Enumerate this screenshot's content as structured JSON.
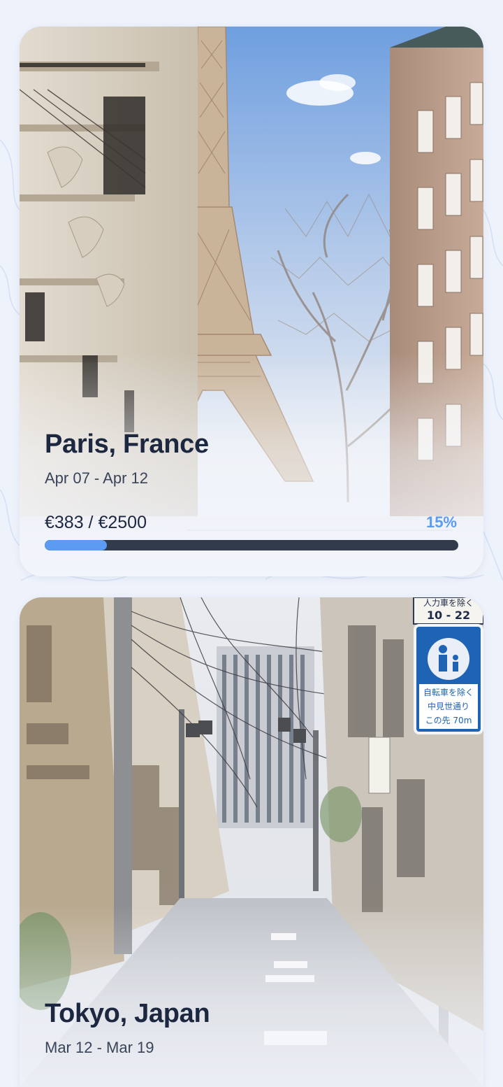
{
  "trips": [
    {
      "city": "Paris, France",
      "dates": "Apr 07 - Apr 12",
      "budget": "€383 / €2500",
      "percent_label": "15%",
      "progress": 0.15
    },
    {
      "city": "Tokyo, Japan",
      "dates": "Mar 12 - Mar 19"
    }
  ],
  "tokyo_signs": {
    "top_sign_line1": "人力車を除く",
    "top_sign_line2": "10 - 22",
    "main_sign_line1": "自転車を除く",
    "main_sign_line2": "中見世通り",
    "main_sign_line3": "この先 70m"
  },
  "colors": {
    "accent": "#5b9cf2",
    "track": "#323b4b",
    "title": "#1c2740",
    "background": "#eef2fb"
  }
}
